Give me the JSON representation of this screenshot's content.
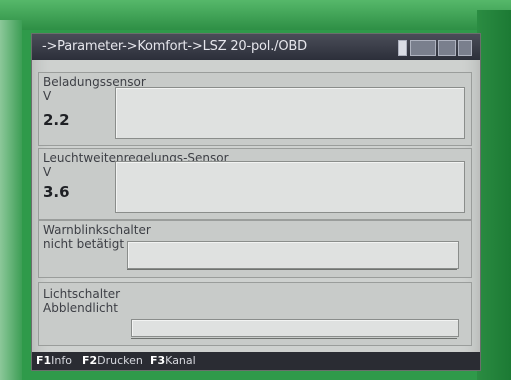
{
  "header": {
    "title": "->Parameter->Komfort->LSZ 20-pol./OBD",
    "icons": [
      "status-icon",
      "keyboard-icon",
      "printer-icon",
      "window-icon"
    ]
  },
  "panels": [
    {
      "label": "Beladungssensor",
      "unit": "V",
      "value": "2.2"
    },
    {
      "label": "Leuchtweitenregelungs-Sensor",
      "unit": "V",
      "value": "3.6"
    },
    {
      "label": "Warnblinkschalter",
      "status": "nicht betätigt"
    },
    {
      "label": "Lichtschalter",
      "status": "Abblendlicht"
    }
  ],
  "footer": {
    "f1_key": "F1",
    "f1_label": "Info",
    "f2_key": "F2",
    "f2_label": "Drucken",
    "f3_key": "F3",
    "f3_label": "Kanal"
  },
  "colors": {
    "bezel": "#2f9a4a",
    "screen": "#ced1cf",
    "titlebar": "#2c2f3a"
  }
}
